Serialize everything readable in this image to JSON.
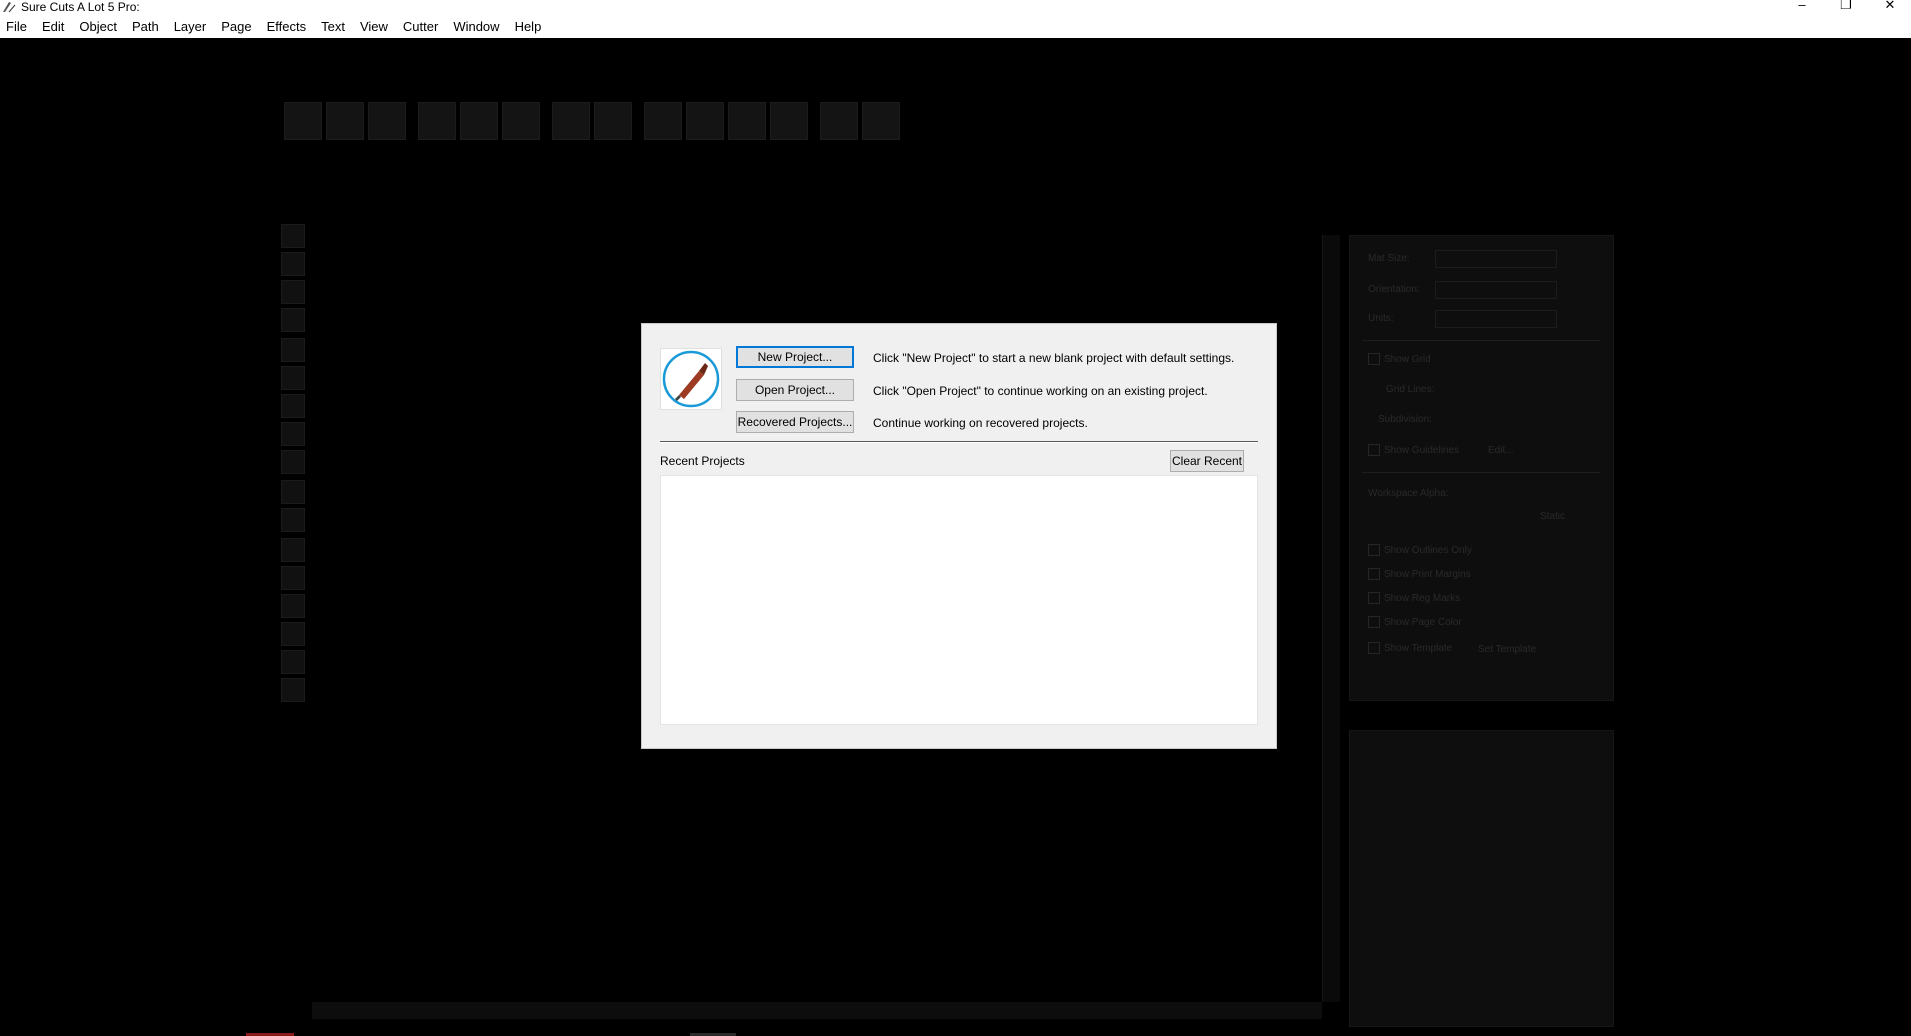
{
  "window": {
    "title": "Sure Cuts A Lot 5 Pro:",
    "controls": [
      "–",
      "❐",
      "✕"
    ]
  },
  "menubar": {
    "items": [
      "File",
      "Edit",
      "Object",
      "Path",
      "Layer",
      "Page",
      "Effects",
      "Text",
      "View",
      "Cutter",
      "Window",
      "Help"
    ]
  },
  "side_panel": {
    "mat_size_label": "Mat Size:",
    "orientation_label": "Orientation:",
    "units_label": "Units:",
    "show_grid_label": "Show Grid",
    "grid_lines_label": "Grid Lines:",
    "subdivision_label": "Subdivision:",
    "show_guidelines_label": "Show Guidelines",
    "edit_button": "Edit...",
    "workspace_alpha_label": "Workspace Alpha:",
    "static_label": "Static",
    "show_outlines_only_label": "Show Outlines Only",
    "show_print_margins_label": "Show Print Margins",
    "show_reg_marks_label": "Show Reg Marks",
    "show_page_color_label": "Show Page Color",
    "show_template_label": "Show Template",
    "set_template_button": "Set Template"
  },
  "dialog": {
    "new_project_button": "New Project...",
    "new_project_desc": "Click \"New Project\" to start a new blank project with default settings.",
    "open_project_button": "Open Project...",
    "open_project_desc": "Click \"Open Project\" to continue working on an existing project.",
    "recovered_projects_button": "Recovered Projects...",
    "recovered_projects_desc": "Continue working on recovered projects.",
    "recent_projects_label": "Recent Projects",
    "clear_recent_button": "Clear Recent",
    "recent_projects": []
  },
  "colors": {
    "focus_border": "#0078d7",
    "logo_ring": "#1a9ad6",
    "logo_blade": "#9c3b22"
  }
}
